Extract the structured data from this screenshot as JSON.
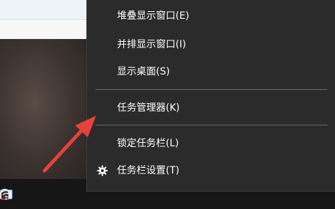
{
  "context_menu": {
    "items": [
      {
        "label": "堆叠显示窗口(E)"
      },
      {
        "label": "并排显示窗口(I)"
      },
      {
        "label": "显示桌面(S)"
      },
      {
        "label": "任务管理器(K)"
      },
      {
        "label": "锁定任务栏(L)"
      },
      {
        "label": "任务栏设置(T)",
        "icon": "gear-icon"
      }
    ]
  },
  "taskbar": {
    "tray_icons": [
      "chevron-up-icon",
      "app-tray-icon",
      "qq-tray-icon",
      "wifi-icon"
    ]
  },
  "annotation": {
    "color": "#e8413a",
    "icon": "pointer-arrow"
  },
  "colors": {
    "menu_bg": "#2b2b2b",
    "menu_text": "#ffffff",
    "separator": "#6a6a6a",
    "taskbar_bg": "#161616"
  }
}
